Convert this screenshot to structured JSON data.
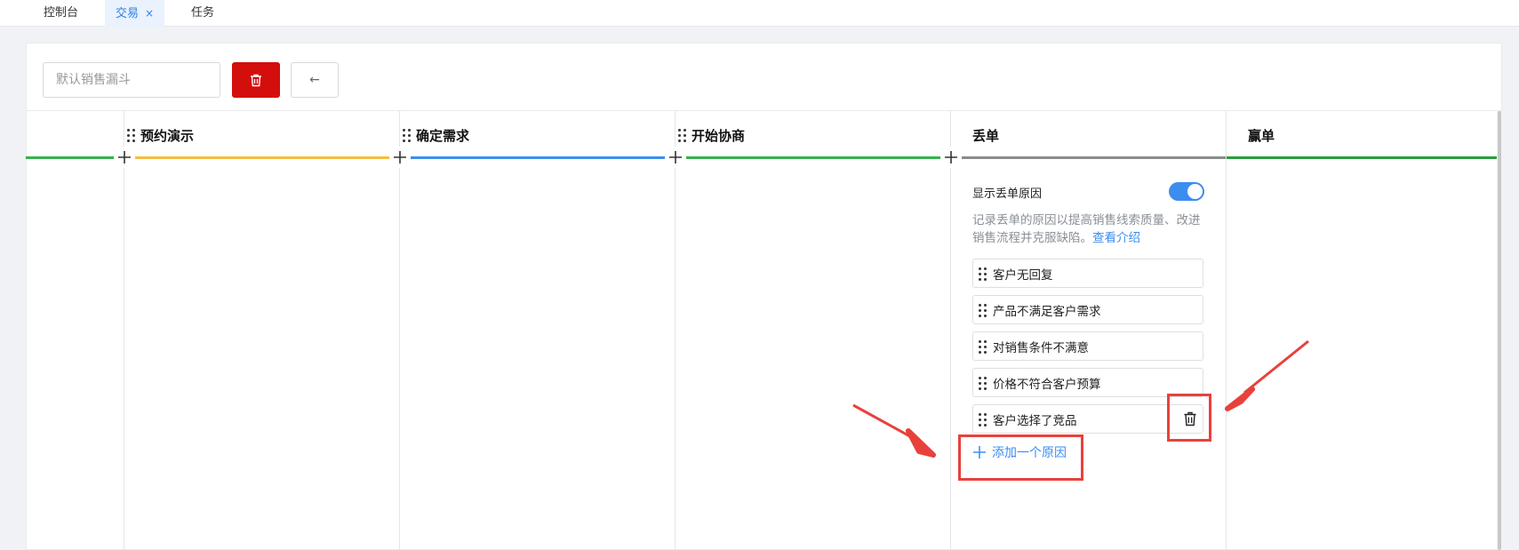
{
  "tabs": [
    {
      "label": "控制台"
    },
    {
      "label": "交易",
      "close": "×"
    },
    {
      "label": "任务"
    }
  ],
  "toolbar": {
    "pipeline_name_placeholder": "默认销售漏斗",
    "back_label": "←"
  },
  "stages": [
    {
      "name": "预约演示",
      "color": "#f5bd3f"
    },
    {
      "name": "确定需求",
      "color": "#3d8ef0"
    },
    {
      "name": "开始协商",
      "color": "#37b24d"
    },
    {
      "name": "丢单",
      "color": "#8c8c8c"
    },
    {
      "name": "赢单",
      "color": "#2a9d3a"
    }
  ],
  "lost_settings": {
    "toggle_label": "显示丢单原因",
    "toggle_on": true,
    "description": "记录丢单的原因以提高销售线索质量、改进销售流程并克服缺陷。",
    "link": "查看介绍",
    "reasons": [
      "客户无回复",
      "产品不满足客户需求",
      "对销售条件不满意",
      "价格不符合客户预算",
      "客户选择了竞品"
    ],
    "add_reason_label": "添加一个原因"
  },
  "colors": {
    "accent": "#3b8df0",
    "danger": "#d40d0d",
    "annotation": "#e8413c",
    "first_line": "#37b24d"
  },
  "icons": {
    "delete": "trash-icon",
    "back": "arrow-left-icon",
    "add": "plus-icon",
    "drag": "drag-handle-icon"
  }
}
